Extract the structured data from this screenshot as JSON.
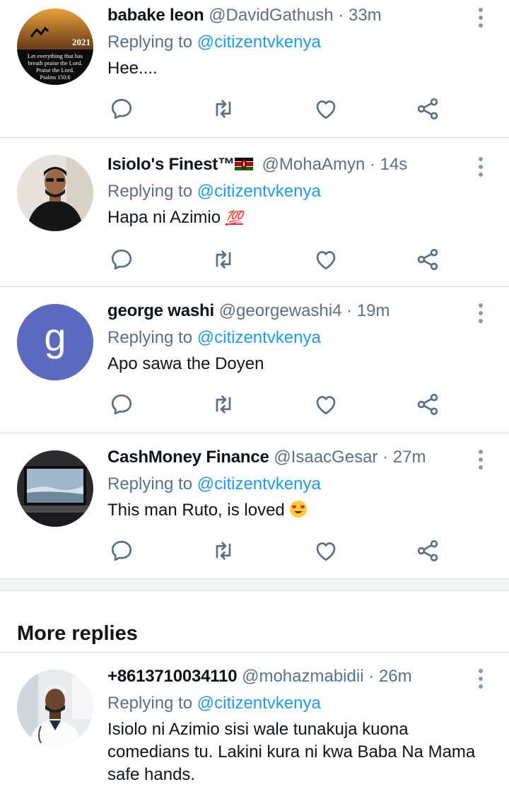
{
  "tweets": [
    {
      "name": "babake leon",
      "handle": "@DavidGathush",
      "time": "33m",
      "replying_prefix": "Replying to ",
      "mention": "@citizentvkenya",
      "text": "Hee....",
      "avatar_text": {
        "year": "2021",
        "line1": "Let everything that has",
        "line2": "breath praise the Lord.",
        "line3": "Praise the Lord.",
        "line4": "Psalms 150:6"
      }
    },
    {
      "name": "Isiolo's Finest™",
      "handle": "@MohaAmyn",
      "time": "14s",
      "replying_prefix": "Replying to ",
      "mention": "@citizentvkenya",
      "text": "Hapa ni Azimio",
      "emoji": "💯"
    },
    {
      "name": "george washi",
      "handle": "@georgewashi4",
      "time": "19m",
      "replying_prefix": "Replying to ",
      "mention": "@citizentvkenya",
      "text": "Apo sawa the Doyen",
      "avatar_letter": "g",
      "avatar_color": "#5c6bc0"
    },
    {
      "name": "CashMoney Finance",
      "handle": "@IsaacGesar",
      "time": "27m",
      "replying_prefix": "Replying to ",
      "mention": "@citizentvkenya",
      "text": "This man Ruto, is loved"
    }
  ],
  "more_replies_title": "More replies",
  "more_tweet": {
    "name": "+8613710034110",
    "handle": "@mohazmabidii",
    "time": "26m",
    "replying_prefix": "Replying to ",
    "mention": "@citizentvkenya",
    "text": "Isiolo ni Azimio sisi wale tunakuja kuona comedians tu. Lakini kura ni kwa Baba Na Mama safe hands."
  },
  "separator": "·",
  "icons": [
    "reply-icon",
    "retweet-icon",
    "like-icon",
    "share-icon",
    "more-options-icon"
  ],
  "colors": {
    "link": "#1d9bf0",
    "muted": "#5b7083",
    "icon": "#5b7083"
  }
}
